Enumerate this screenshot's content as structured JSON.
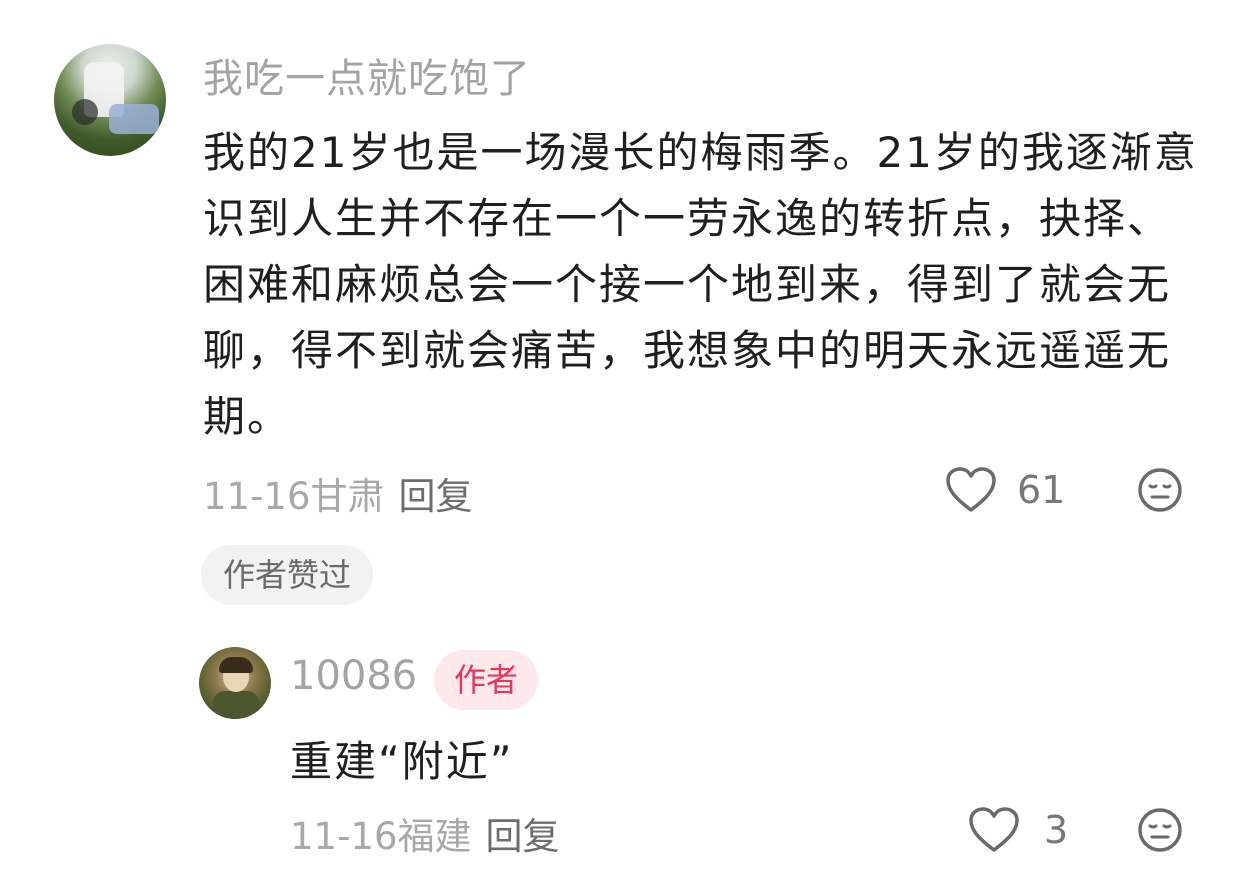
{
  "comment": {
    "username": "我吃一点就吃饱了",
    "text": "我的21岁也是一场漫长的梅雨季。21岁的我逐渐意识到人生并不存在一个一劳永逸的转折点，抉择、困难和麻烦总会一个接一个地到来，得到了就会无聊，得不到就会痛苦，我想象中的明天永远遥遥无期。",
    "date_location": "11-16甘肃",
    "reply_label": "回复",
    "like_count": "61",
    "author_liked_chip": "作者赞过"
  },
  "reply": {
    "username": "10086",
    "author_badge": "作者",
    "text": "重建“附近”",
    "date_location": "11-16福建",
    "reply_label": "回复",
    "like_count": "3"
  },
  "icons": {
    "like": "heart-outline-icon",
    "dislike": "meh-face-icon"
  },
  "colors": {
    "author_badge_bg": "#fde9ec",
    "author_badge_text": "#e8365a",
    "secondary_text": "#a8a8a8"
  }
}
